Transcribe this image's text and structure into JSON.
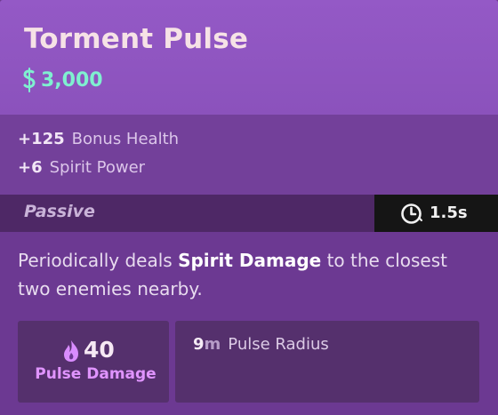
{
  "item": {
    "title": "Torment Pulse",
    "cost": "3,000",
    "cost_icon": "souls-currency-icon",
    "stats": [
      {
        "value": "+125",
        "label": "Bonus Health"
      },
      {
        "value": "+6",
        "label": "Spirit Power"
      }
    ],
    "passive": {
      "label": "Passive",
      "cooldown": "1.5s",
      "cooldown_icon": "cooldown-clock-icon"
    },
    "description": {
      "pre": "Periodically deals ",
      "highlight": "Spirit Damage",
      "post": " to the closest two enemies nearby."
    },
    "properties": {
      "damage": {
        "value": "40",
        "label": "Pulse Damage",
        "icon": "spirit-flame-icon"
      },
      "radius": {
        "value": "9",
        "unit": "m",
        "label": "Pulse Radius"
      }
    }
  },
  "colors": {
    "header": "#9459c6",
    "title": "#f6e2e6",
    "cost": "#7ff0d0",
    "spirit_label": "#e094ff",
    "cooldown_bg": "#151515",
    "bar_bg": "#4e2866"
  }
}
